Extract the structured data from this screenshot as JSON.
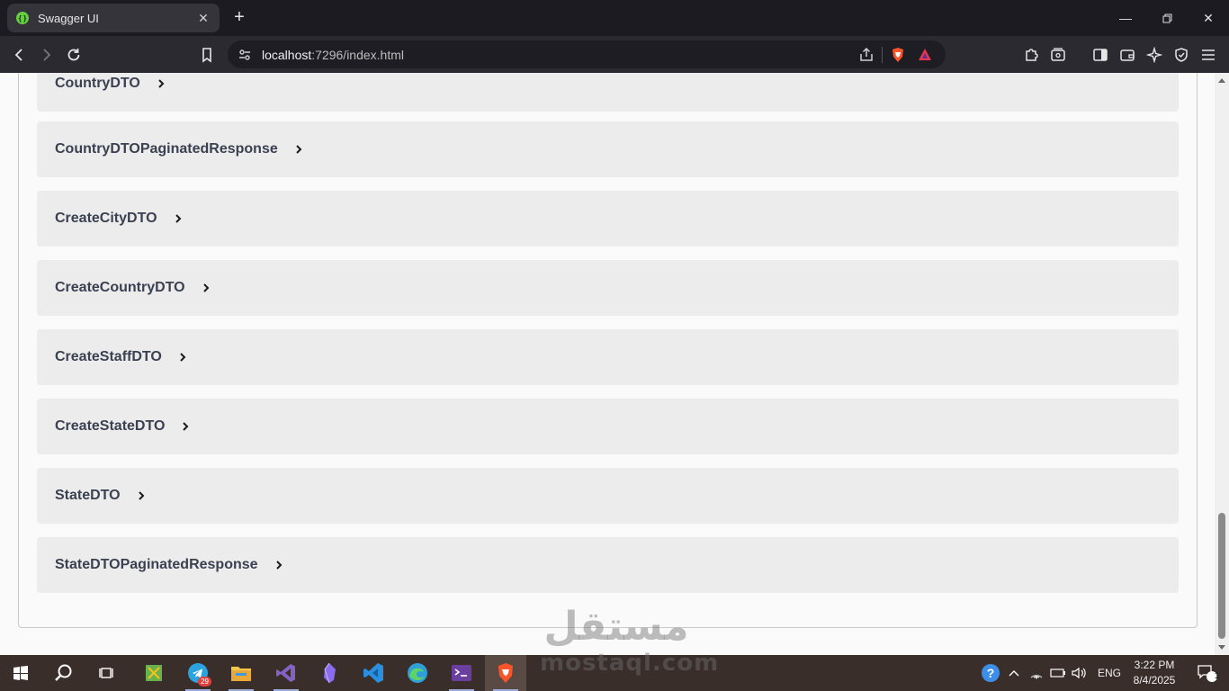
{
  "browser": {
    "tab": {
      "title": "Swagger UI"
    },
    "address": {
      "host": "localhost",
      "rest": ":7296/index.html"
    }
  },
  "models": [
    {
      "name": "CountryDTO"
    },
    {
      "name": "CountryDTOPaginatedResponse"
    },
    {
      "name": "CreateCityDTO"
    },
    {
      "name": "CreateCountryDTO"
    },
    {
      "name": "CreateStaffDTO"
    },
    {
      "name": "CreateStateDTO"
    },
    {
      "name": "StateDTO"
    },
    {
      "name": "StateDTOPaginatedResponse"
    }
  ],
  "taskbar": {
    "telegram_badge": "29",
    "language": "ENG",
    "time": "3:22 PM",
    "date": "8/4/2025",
    "notification_count": "1"
  },
  "watermark": {
    "arabic": "مستقل",
    "latin": "mostaql.com"
  },
  "colors": {
    "accent": "#62d13c",
    "model_bg": "#ececec",
    "model_text": "#3b4151"
  }
}
